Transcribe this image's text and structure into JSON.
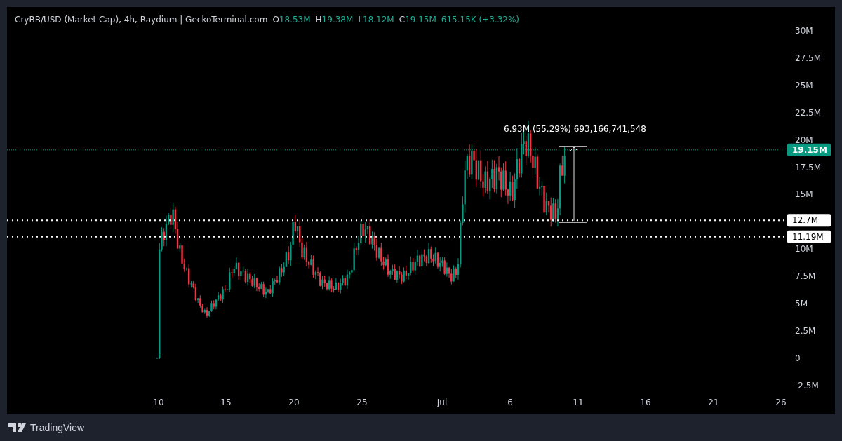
{
  "legend": {
    "title": "CryBB/USD (Market Cap), 4h, Raydium | GeckoTerminal.com",
    "ohlc": [
      {
        "label": "O",
        "value": "18.53M"
      },
      {
        "label": "H",
        "value": "19.38M"
      },
      {
        "label": "L",
        "value": "18.12M"
      },
      {
        "label": "C",
        "value": "19.15M"
      }
    ],
    "change": "615.15K (+3.32%)"
  },
  "price_axis": [
    "30M",
    "27.5M",
    "25M",
    "22.5M",
    "20M",
    "17.5M",
    "15M",
    "10M",
    "7.5M",
    "5M",
    "2.5M",
    "0",
    "-2.5M"
  ],
  "time_axis": [
    "10",
    "15",
    "20",
    "25",
    "Jul",
    "6",
    "11",
    "16",
    "21",
    "26"
  ],
  "price_tags": [
    {
      "label": "19.15M",
      "kind": "last"
    },
    {
      "label": "12.7M",
      "kind": "level"
    },
    {
      "label": "11.19M",
      "kind": "level"
    }
  ],
  "measurement": {
    "text": "6.93M (55.29%) 693,166,741,548"
  },
  "footer": {
    "brand": "TradingView"
  }
}
